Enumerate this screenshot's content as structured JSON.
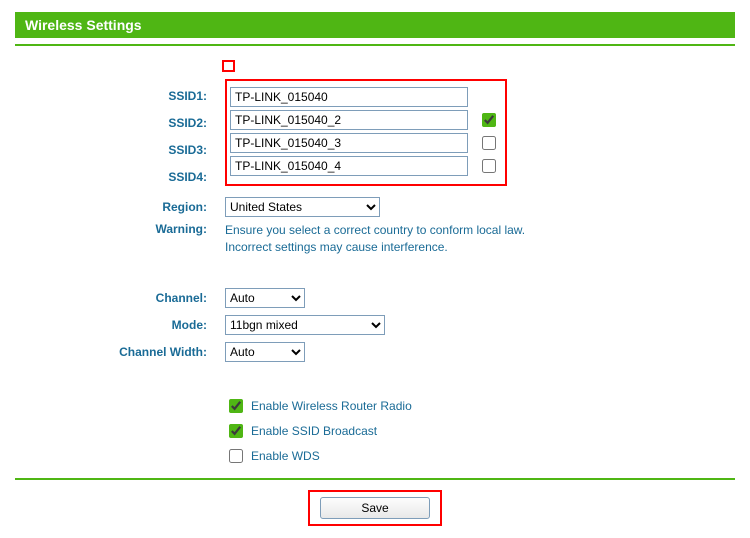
{
  "header": {
    "title": "Wireless Settings"
  },
  "labels": {
    "ssid1": "SSID1:",
    "ssid2": "SSID2:",
    "ssid3": "SSID3:",
    "ssid4": "SSID4:",
    "region": "Region:",
    "warning": "Warning:",
    "channel": "Channel:",
    "mode": "Mode:",
    "channel_width": "Channel Width:"
  },
  "ssid": {
    "s1": "TP-LINK_015040",
    "s2": "TP-LINK_015040_2",
    "s3": "TP-LINK_015040_3",
    "s4": "TP-LINK_015040_4",
    "chk2": true,
    "chk3": false,
    "chk4": false
  },
  "region": {
    "selected": "United States"
  },
  "warning_text1": "Ensure you select a correct country to conform local law.",
  "warning_text2": "Incorrect settings may cause interference.",
  "channel": {
    "selected": "Auto"
  },
  "mode": {
    "selected": "11bgn mixed"
  },
  "channel_width": {
    "selected": "Auto"
  },
  "options": {
    "enable_radio": {
      "label": "Enable Wireless Router Radio",
      "checked": true
    },
    "enable_broadcast": {
      "label": "Enable SSID Broadcast",
      "checked": true
    },
    "enable_wds": {
      "label": "Enable WDS",
      "checked": false
    }
  },
  "buttons": {
    "save": "Save"
  }
}
